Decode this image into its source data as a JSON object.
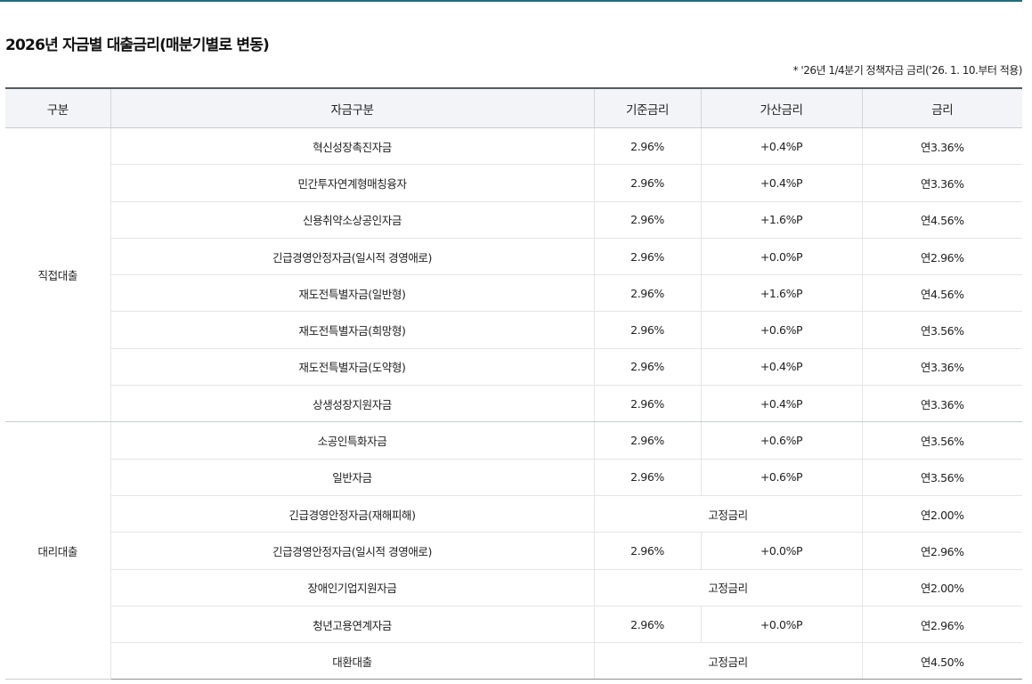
{
  "title": "2026년 자금별 대출금리(매분기별로 변동)",
  "note": "* '26년 1/4분기 정책자금 금리('26. 1. 10.부터 적용)",
  "colors": {
    "accent": "#1f6f7a",
    "header_bg": "#f2f4f7"
  },
  "table": {
    "headers": [
      "구분",
      "자금구분",
      "기준금리",
      "가산금리",
      "금리"
    ],
    "groups": [
      {
        "label": "직접대출",
        "rows": [
          {
            "fund": "혁신성장촉진자금",
            "base": "2.96%",
            "add": "+0.4%P",
            "fixed": "",
            "rate": "연3.36%"
          },
          {
            "fund": "민간투자연계형매칭융자",
            "base": "2.96%",
            "add": "+0.4%P",
            "fixed": "",
            "rate": "연3.36%"
          },
          {
            "fund": "신용취약소상공인자금",
            "base": "2.96%",
            "add": "+1.6%P",
            "fixed": "",
            "rate": "연4.56%"
          },
          {
            "fund": "긴급경영안정자금(일시적 경영애로)",
            "base": "2.96%",
            "add": "+0.0%P",
            "fixed": "",
            "rate": "연2.96%"
          },
          {
            "fund": "재도전특별자금(일반형)",
            "base": "2.96%",
            "add": "+1.6%P",
            "fixed": "",
            "rate": "연4.56%"
          },
          {
            "fund": "재도전특별자금(희망형)",
            "base": "2.96%",
            "add": "+0.6%P",
            "fixed": "",
            "rate": "연3.56%"
          },
          {
            "fund": "재도전특별자금(도약형)",
            "base": "2.96%",
            "add": "+0.4%P",
            "fixed": "",
            "rate": "연3.36%"
          },
          {
            "fund": "상생성장지원자금",
            "base": "2.96%",
            "add": "+0.4%P",
            "fixed": "",
            "rate": "연3.36%"
          }
        ]
      },
      {
        "label": "대리대출",
        "rows": [
          {
            "fund": "소공인특화자금",
            "base": "2.96%",
            "add": "+0.6%P",
            "fixed": "",
            "rate": "연3.56%"
          },
          {
            "fund": "일반자금",
            "base": "2.96%",
            "add": "+0.6%P",
            "fixed": "",
            "rate": "연3.56%"
          },
          {
            "fund": "긴급경영안정자금(재해피해)",
            "base": "",
            "add": "",
            "fixed": "고정금리",
            "rate": "연2.00%"
          },
          {
            "fund": "긴급경영안정자금(일시적 경영애로)",
            "base": "2.96%",
            "add": "+0.0%P",
            "fixed": "",
            "rate": "연2.96%"
          },
          {
            "fund": "장애인기업지원자금",
            "base": "",
            "add": "",
            "fixed": "고정금리",
            "rate": "연2.00%"
          },
          {
            "fund": "청년고용연계자금",
            "base": "2.96%",
            "add": "+0.0%P",
            "fixed": "",
            "rate": "연2.96%"
          },
          {
            "fund": "대환대출",
            "base": "",
            "add": "",
            "fixed": "고정금리",
            "rate": "연4.50%"
          }
        ]
      }
    ]
  }
}
